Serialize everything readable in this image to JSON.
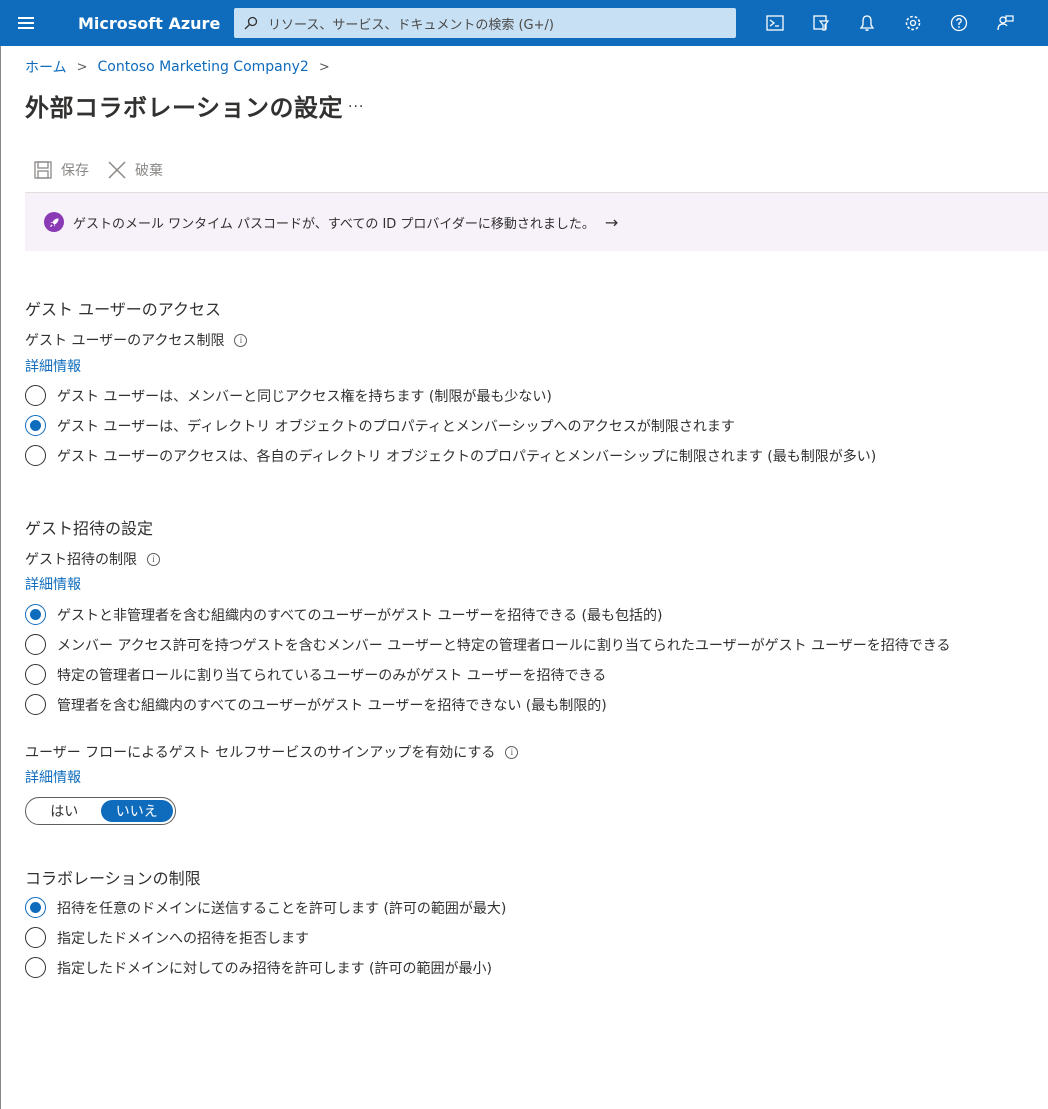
{
  "topbar": {
    "brand": "Microsoft Azure",
    "search_placeholder": "リソース、サービス、ドキュメントの検索 (G+/)",
    "icons": [
      "cloud-shell-icon",
      "directory-filter-icon",
      "notifications-icon",
      "settings-icon",
      "help-icon",
      "feedback-icon"
    ]
  },
  "breadcrumb": {
    "home": "ホーム",
    "tenant": "Contoso Marketing Company2"
  },
  "page": {
    "title": "外部コラボレーションの設定",
    "more": "..."
  },
  "commands": {
    "save": "保存",
    "discard": "破棄"
  },
  "banner": {
    "text": "ゲストのメール ワンタイム パスコードが、すべての ID プロバイダーに移動されました。",
    "arrow": "→"
  },
  "guest_access": {
    "heading": "ゲスト ユーザーのアクセス",
    "label": "ゲスト ユーザーのアクセス制限",
    "learn_more": "詳細情報",
    "options": [
      {
        "label": "ゲスト ユーザーは、メンバーと同じアクセス権を持ちます (制限が最も少ない)",
        "checked": false
      },
      {
        "label": "ゲスト ユーザーは、ディレクトリ オブジェクトのプロパティとメンバーシップへのアクセスが制限されます",
        "checked": true
      },
      {
        "label": "ゲスト ユーザーのアクセスは、各自のディレクトリ オブジェクトのプロパティとメンバーシップに制限されます (最も制限が多い)",
        "checked": false
      }
    ]
  },
  "guest_invite": {
    "heading": "ゲスト招待の設定",
    "label": "ゲスト招待の制限",
    "learn_more": "詳細情報",
    "options": [
      {
        "label": "ゲストと非管理者を含む組織内のすべてのユーザーがゲスト ユーザーを招待できる (最も包括的)",
        "checked": true
      },
      {
        "label": "メンバー アクセス許可を持つゲストを含むメンバー ユーザーと特定の管理者ロールに割り当てられたユーザーがゲスト ユーザーを招待できる",
        "checked": false
      },
      {
        "label": "特定の管理者ロールに割り当てられているユーザーのみがゲスト ユーザーを招待できる",
        "checked": false
      },
      {
        "label": "管理者を含む組織内のすべてのユーザーがゲスト ユーザーを招待できない (最も制限的)",
        "checked": false
      }
    ],
    "self_service_label": "ユーザー フローによるゲスト セルフサービスのサインアップを有効にする",
    "self_service_learn_more": "詳細情報",
    "toggle_yes": "はい",
    "toggle_no": "いいえ",
    "toggle_selected": "いいえ"
  },
  "collab": {
    "heading": "コラボレーションの制限",
    "options": [
      {
        "label": "招待を任意のドメインに送信することを許可します (許可の範囲が最大)",
        "checked": true
      },
      {
        "label": "指定したドメインへの招待を拒否します",
        "checked": false
      },
      {
        "label": "指定したドメインに対してのみ招待を許可します (許可の範囲が最小)",
        "checked": false
      }
    ]
  },
  "colors": {
    "topbar": "#0f6cbd",
    "accent": "#0f6cbd",
    "banner_bg": "#f7f1fa",
    "rocket": "#8a3ab5"
  }
}
